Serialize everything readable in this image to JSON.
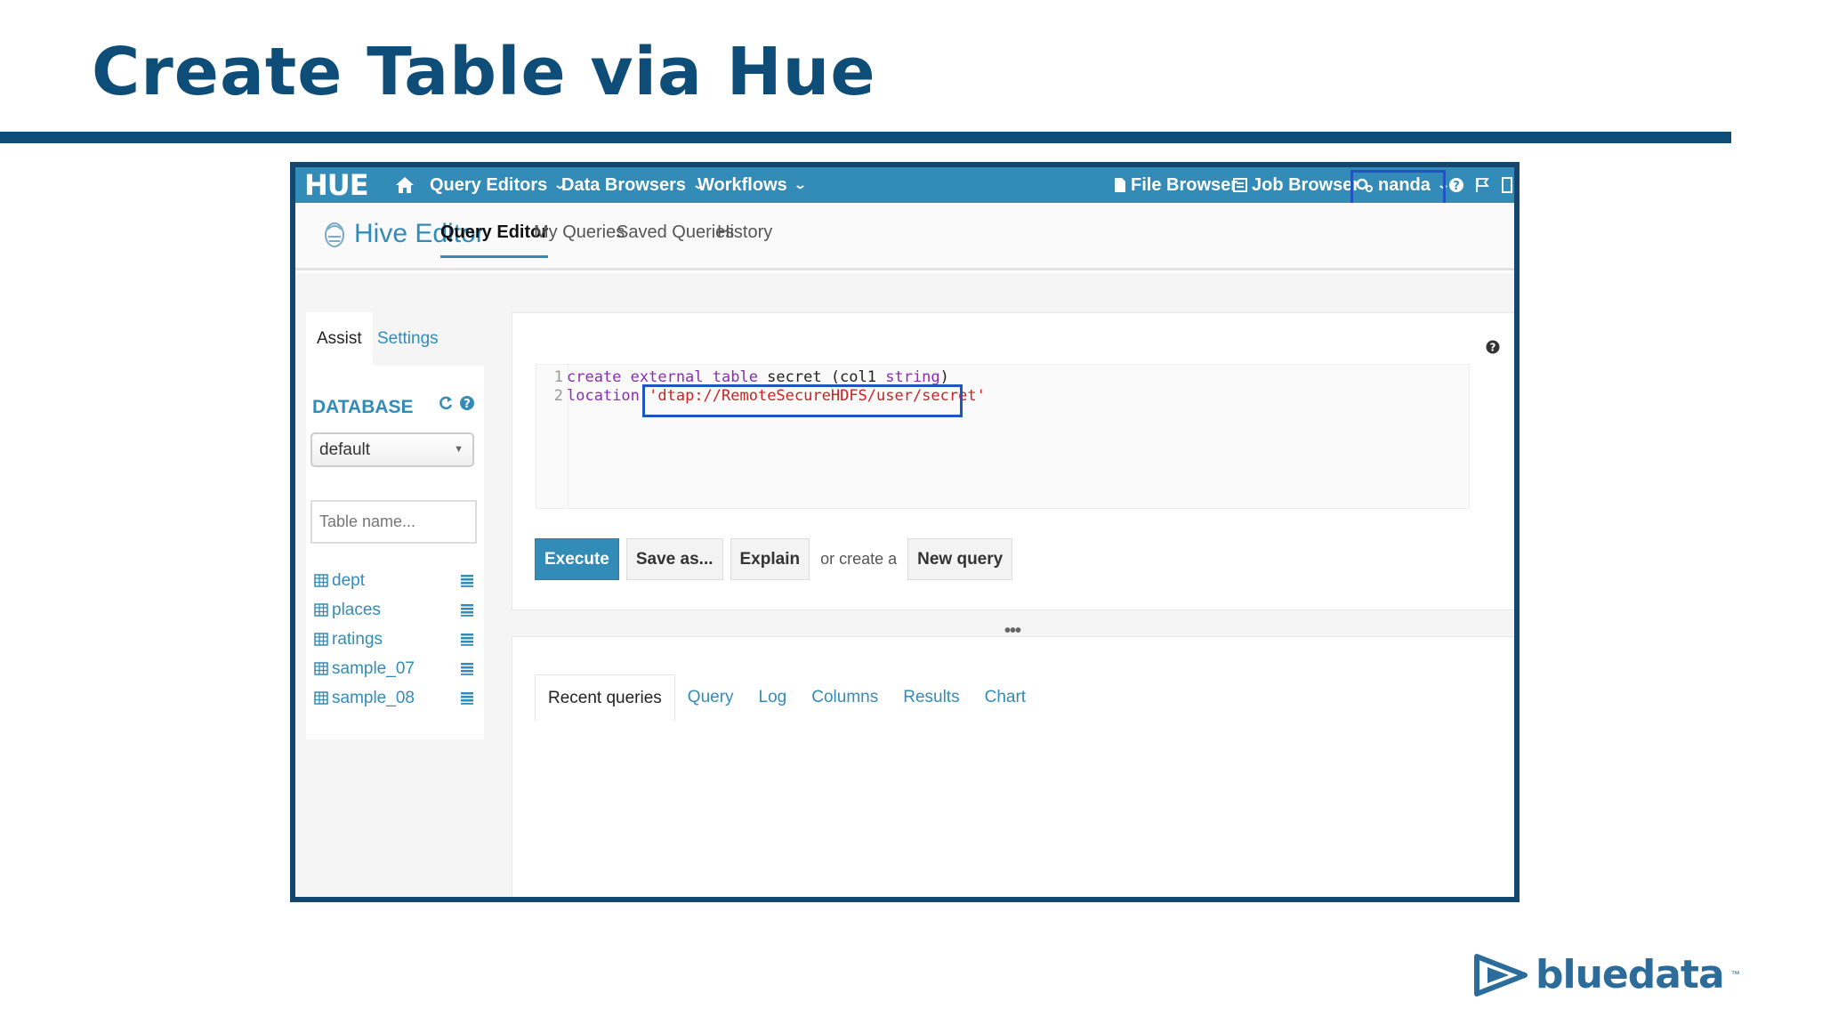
{
  "slide": {
    "title": "Create Table via Hue"
  },
  "hue_nav": {
    "logo": "HUE",
    "query_editors": "Query Editors",
    "data_browsers": "Data Browsers",
    "workflows": "Workflows",
    "file_browser": "File Browser",
    "job_browser": "Job Browser",
    "user": "nanda"
  },
  "sub_header": {
    "app_name": "Hive Editor",
    "tabs": [
      "Query Editor",
      "My Queries",
      "Saved Queries",
      "History"
    ],
    "active_tab": "Query Editor"
  },
  "sidebar": {
    "tabs": [
      "Assist",
      "Settings"
    ],
    "database_label": "DATABASE",
    "database_selected": "default",
    "table_search_placeholder": "Table name...",
    "tables": [
      "dept",
      "places",
      "ratings",
      "sample_07",
      "sample_08"
    ]
  },
  "editor": {
    "lines": [
      {
        "number": "1",
        "keyword_a": "create external table",
        "text": " secret (col1 ",
        "keyword_b": "string",
        "tail": ")"
      },
      {
        "number": "2",
        "keyword_a": "location",
        "text": " ",
        "string": "'dtap://RemoteSecureHDFS/user/secret'"
      }
    ],
    "execute": "Execute",
    "save_as": "Save as...",
    "explain": "Explain",
    "or_create": "or create a",
    "new_query": "New query",
    "divider_dots": "•••"
  },
  "results": {
    "tabs": [
      "Recent queries",
      "Query",
      "Log",
      "Columns",
      "Results",
      "Chart"
    ],
    "active_tab": "Recent queries"
  },
  "brand": {
    "name": "bluedata",
    "tm": "™"
  },
  "colors": {
    "slide_blue": "#0e4d78",
    "hue_blue": "#338bb8",
    "highlight_box": "#1f55c0"
  }
}
